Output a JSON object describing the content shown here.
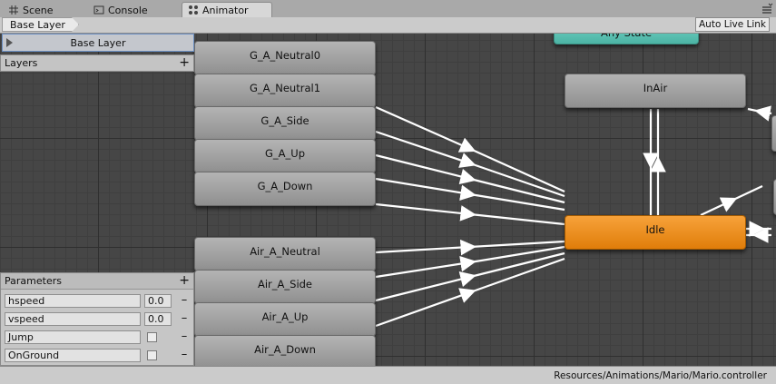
{
  "tabs": [
    {
      "label": "Scene",
      "icon": "grid-icon",
      "active": false
    },
    {
      "label": "Console",
      "icon": "console-icon",
      "active": false
    },
    {
      "label": "Animator",
      "icon": "animator-icon",
      "active": true
    }
  ],
  "toolbar": {
    "breadcrumb": "Base Layer",
    "live_link": "Auto Live Link"
  },
  "layers": {
    "header": "Layers",
    "item": "Base Layer"
  },
  "parameters": {
    "header": "Parameters",
    "items": [
      {
        "name": "hspeed",
        "type": "float",
        "value": "0.0"
      },
      {
        "name": "vspeed",
        "type": "float",
        "value": "0.0"
      },
      {
        "name": "Jump",
        "type": "bool",
        "value": false
      },
      {
        "name": "OnGround",
        "type": "bool",
        "value": false
      }
    ]
  },
  "states": {
    "any_state": "Any State",
    "in_air": "InAir",
    "idle": "Idle",
    "ground": [
      "G_A_Neutral0",
      "G_A_Neutral1",
      "G_A_Side",
      "G_A_Up",
      "G_A_Down"
    ],
    "air": [
      "Air_A_Neutral",
      "Air_A_Side",
      "Air_A_Up",
      "Air_A_Down"
    ]
  },
  "status": {
    "path": "Resources/Animations/Mario/Mario.controller"
  },
  "colors": {
    "default_state": "#f08c1c",
    "any_state": "#5fc4b6",
    "state": "#a3a3a3",
    "graph_bg": "#464646",
    "transition": "#ffffff"
  }
}
